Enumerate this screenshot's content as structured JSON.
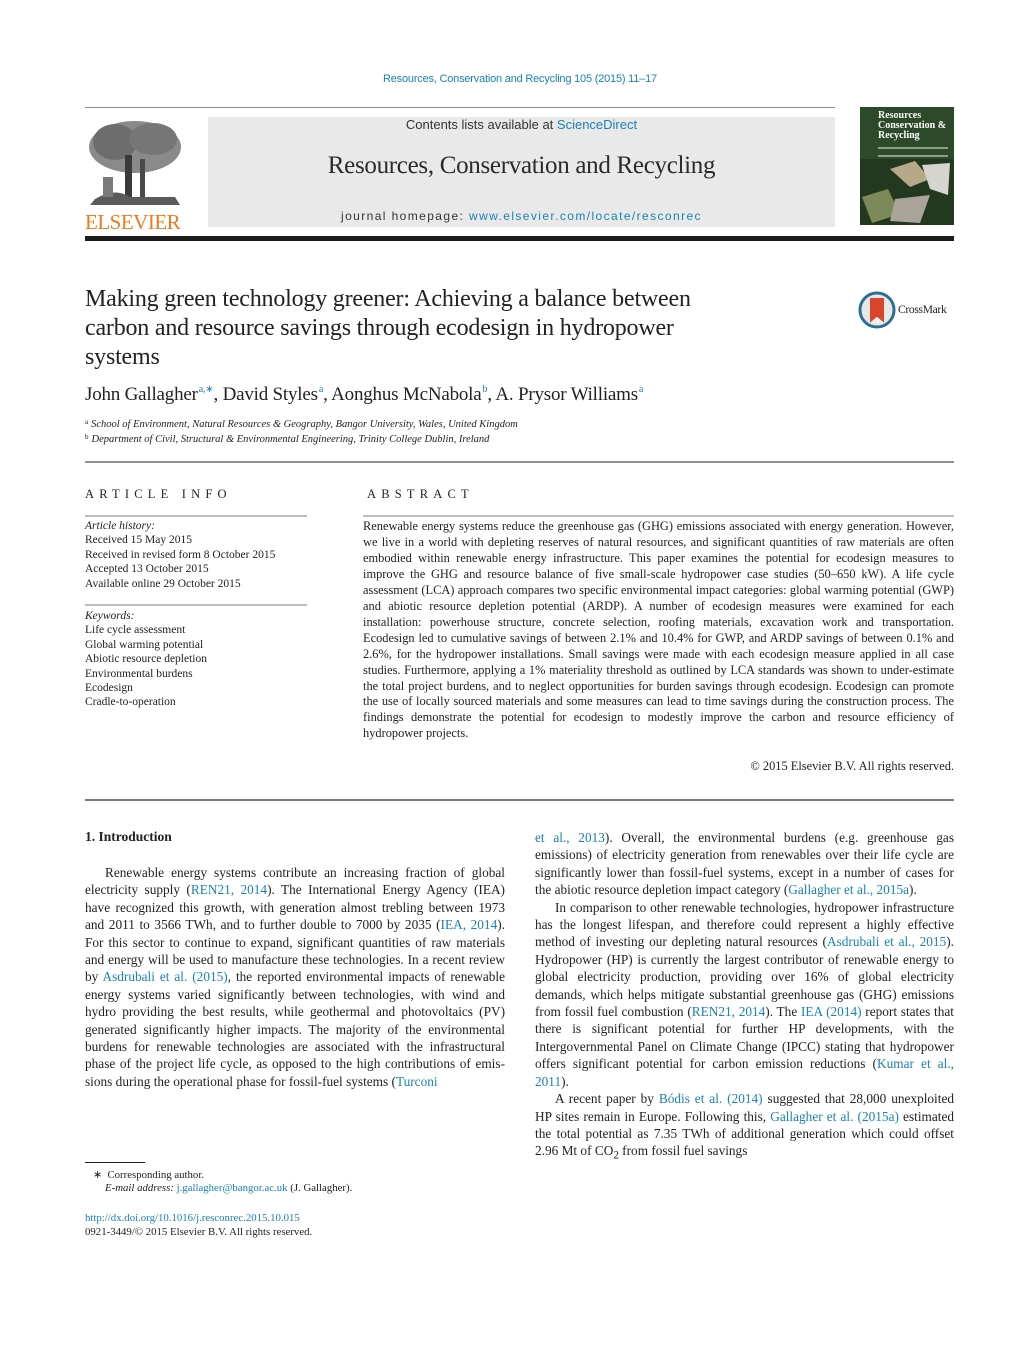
{
  "header": {
    "running_head": "Resources, Conservation and Recycling 105 (2015) 11–17",
    "contents_prefix": "Contents lists available at ",
    "contents_link": "ScienceDirect",
    "journal_title": "Resources, Conservation and Recycling",
    "homepage_prefix": "journal homepage: ",
    "homepage_link": "www.elsevier.com/locate/resconrec",
    "publisher_logo_text": "ELSEVIER",
    "cover": {
      "line1": "Resources",
      "line2": "Conservation &",
      "line3": "Recycling"
    },
    "colors": {
      "link": "#1a83b3",
      "elsevier_orange": "#f07a1a",
      "masthead_bg": "#e9e9e9"
    }
  },
  "article": {
    "title_lines": [
      "Making green technology greener: Achieving a balance between",
      "carbon and resource savings through ecodesign in hydropower",
      "systems"
    ],
    "crossmark_label": "CrossMark",
    "authors": [
      {
        "name": "John Gallagher",
        "sup": "a,∗"
      },
      {
        "name": "David Styles",
        "sup": "a"
      },
      {
        "name": "Aonghus McNabola",
        "sup": "b"
      },
      {
        "name": "A. Prysor Williams",
        "sup": "a"
      }
    ],
    "affiliations": [
      {
        "key": "a",
        "text": "School of Environment, Natural Resources & Geography, Bangor University, Wales, United Kingdom"
      },
      {
        "key": "b",
        "text": "Department of Civil, Structural & Environmental Engineering, Trinity College Dublin, Ireland"
      }
    ]
  },
  "article_info": {
    "heading": "ARTICLE INFO",
    "history_label": "Article history:",
    "history": [
      "Received 15 May 2015",
      "Received in revised form 8 October 2015",
      "Accepted 13 October 2015",
      "Available online 29 October 2015"
    ],
    "keywords_label": "Keywords:",
    "keywords": [
      "Life cycle assessment",
      "Global warming potential",
      "Abiotic resource depletion",
      "Environmental burdens",
      "Ecodesign",
      "Cradle-to-operation"
    ]
  },
  "abstract": {
    "heading": "ABSTRACT",
    "text": "Renewable energy systems reduce the greenhouse gas (GHG) emissions associated with energy genera­tion. However, we live in a world with depleting reserves of natural resources, and significant quantities of raw materials are often embodied within renewable energy infrastructure. This paper examines the potential for ecodesign measures to improve the GHG and resource balance of five small-scale hydropower case studies (50–650 kW). A life cycle assessment (LCA) approach compares two specific environmental impact categories: global warming potential (GWP) and abiotic resource depletion poten­tial (ARDP). A number of ecodesign measures were examined for each installation: powerhouse structure, concrete selection, roofing materials, excavation work and transportation. Ecodesign led to cumula­tive savings of between 2.1% and 10.4% for GWP, and ARDP savings of between 0.1% and 2.6%, for the hydropower installations. Small savings were made with each ecodesign measure applied in all case studies. Furthermore, applying a 1% materiality threshold as outlined by LCA standards was shown to under-estimate the total project burdens, and to neglect opportunities for burden savings through ecode­sign. Ecodesign can promote the use of locally sourced materials and some measures can lead to time savings during the construction process. The findings demonstrate the potential for ecodesign to modestly improve the carbon and resource efficiency of hydropower projects.",
    "copyright": "© 2015 Elsevier B.V. All rights reserved."
  },
  "introduction": {
    "heading": "1.  Introduction",
    "left_paragraph": [
      {
        "t": "Renewable energy systems contribute an increasing fraction of global electricity supply ("
      },
      {
        "link": "REN21, 2014"
      },
      {
        "t": "). The International Energy Agency (IEA) have recognized this growth, with generation almost trebling between 1973 and 2011 to 3566 TWh, and to further dou­ble to 7000 by 2035 ("
      },
      {
        "link": "IEA, 2014"
      },
      {
        "t": "). For this sector to continue to expand, significant quantities of raw materials and energy will be used to manufacture these technologies. In a recent review by "
      },
      {
        "link": "Asdrubali et al. (2015)"
      },
      {
        "t": ", the reported environmental impacts of renewable energy systems varied significantly between tech­nologies, with wind and hydro providing the best results, while geothermal and photovoltaics (PV) generated significantly higher impacts. The majority of the environmental burdens for renewable technologies are associated with the infrastructural phase of the project life cycle, as opposed to the high contributions of emis­sions during the operational phase for fossil-fuel systems ("
      },
      {
        "link": "Turconi"
      }
    ],
    "right_paragraphs": [
      [
        {
          "link": "et al., 2013"
        },
        {
          "t": "). Overall, the environmental burdens (e.g. greenhouse gas emissions) of electricity generation from renewables over their life cycle are significantly lower than fossil-fuel systems, except in a number of cases for the abiotic resource depletion impact category ("
        },
        {
          "link": "Gallagher et al., 2015a"
        },
        {
          "t": ")."
        }
      ],
      [
        {
          "t": "In comparison to other renewable technologies, hydropower infrastructure has the longest lifespan, and therefore could rep­resent a highly effective method of investing our depleting natural resources ("
        },
        {
          "link": "Asdrubali et al., 2015"
        },
        {
          "t": "). Hydropower (HP) is currently the largest contributor of renewable energy to global electricity pro­duction, providing over 16% of global electricity demands, which helps mitigate substantial greenhouse gas (GHG) emissions from fossil fuel combustion ("
        },
        {
          "link": "REN21, 2014"
        },
        {
          "t": "). The "
        },
        {
          "link": "IEA (2014)"
        },
        {
          "t": " report states that there is significant potential for further HP developments, with the Intergovernmental Panel on Climate Change (IPCC) stating that hydropower offers significant potential for carbon emission reduc­tions ("
        },
        {
          "link": "Kumar et al., 2011"
        },
        {
          "t": ")."
        }
      ],
      [
        {
          "t": "A recent paper by "
        },
        {
          "link": "Bódis et al. (2014)"
        },
        {
          "t": " suggested that 28,000 unex­ploited HP sites remain in Europe. Following this, "
        },
        {
          "link": "Gallagher et al. (2015a)"
        },
        {
          "t": " estimated the total potential as 7.35 TWh of additional gen­eration which could offset 2.96 Mt of CO"
        },
        {
          "sub": "2"
        },
        {
          "t": "  from fossil fuel savings"
        }
      ]
    ]
  },
  "footnotes": {
    "corresponding": "Corresponding author.",
    "corresponding_mark": "∗",
    "email_label": "E-mail address: ",
    "email": "j.gallagher@bangor.ac.uk",
    "email_suffix": " (J. Gallagher).",
    "doi": "http://dx.doi.org/10.1016/j.resconrec.2015.10.015",
    "issn_line": "0921-3449/© 2015 Elsevier B.V. All rights reserved."
  }
}
